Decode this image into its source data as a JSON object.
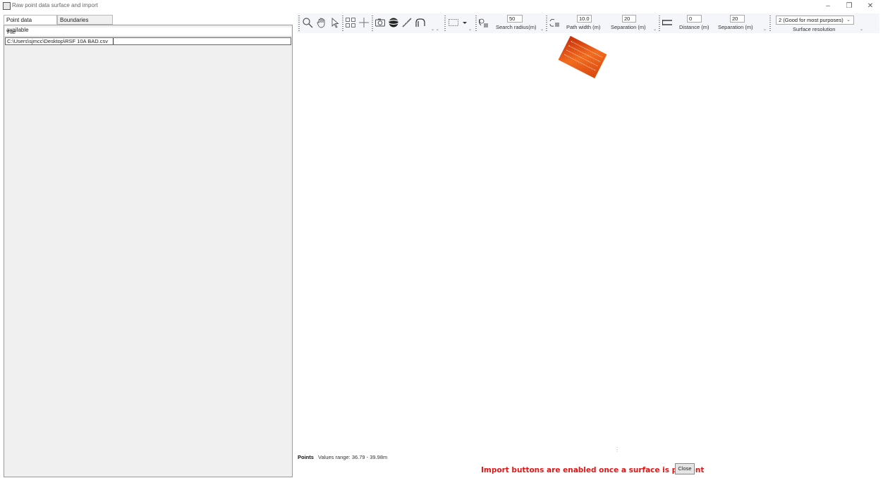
{
  "window": {
    "title": "Raw point data surface and import",
    "minimize": "–",
    "restore": "❐",
    "close": "✕"
  },
  "tabs": [
    {
      "label": "Point data available"
    },
    {
      "label": "Boundaries available"
    }
  ],
  "file_list": {
    "header": "File",
    "rows": [
      "C:\\Users\\sjmcc\\Desktop\\RSF 10A BAD.csv"
    ]
  },
  "toolbar": {
    "search_radius": {
      "value": "50",
      "label": "Search radius(m)"
    },
    "path_width": {
      "value": "10.0",
      "label": "Path width (m)"
    },
    "path_separation": {
      "value": "20",
      "label": "Separation (m)"
    },
    "distance": {
      "value": "0",
      "label": "Distance (m)"
    },
    "distance_separation": {
      "value": "20",
      "label": "Separation (m)"
    },
    "surface_resolution": {
      "value": "2 (Good for most purposes)",
      "label": "Surface resolution"
    }
  },
  "status": {
    "points_label": "Points",
    "values_range": "Values range: 36.79 - 39.98m",
    "import_message": "Import buttons are enabled once a surface is present",
    "close_button": "Close"
  },
  "colors": {
    "accent_red": "#e01616",
    "surface_orange": "#f26c1f",
    "toolbar_bg": "#f4f6fa"
  }
}
